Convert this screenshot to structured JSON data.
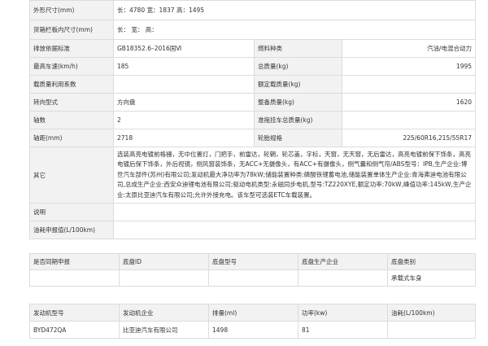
{
  "spec": {
    "rows": [
      {
        "type": "wide",
        "label": "外形尺寸(mm)",
        "value": "长：4780 宽：1837 高：1495"
      },
      {
        "type": "wide",
        "label": "货箱栏板内尺寸(mm)",
        "value": "长：    宽：    高："
      },
      {
        "type": "pair",
        "l1": "排放依据标准",
        "v1": "GB18352.6–2016国Ⅵ",
        "l2": "燃料种类",
        "v2": "汽油/电混合动力"
      },
      {
        "type": "pair",
        "l1": "最高车速(km/h)",
        "v1": "185",
        "l2": "总质量(kg)",
        "v2": "1995"
      },
      {
        "type": "pair",
        "l1": "载质量利用系数",
        "v1": "",
        "l2": "额定载质量(kg)",
        "v2": ""
      },
      {
        "type": "pair",
        "l1": "转向型式",
        "v1": "方向盘",
        "l2": "整备质量(kg)",
        "v2": "1620"
      },
      {
        "type": "pair",
        "l1": "轴数",
        "v1": "2",
        "l2": "准拖挂车总质量(kg)",
        "v2": ""
      },
      {
        "type": "pair",
        "l1": "轴距(mm)",
        "v1": "2718",
        "l2": "轮胎规格",
        "v2": "225/60R16,215/55R17"
      },
      {
        "type": "other",
        "label": "其它",
        "value": "选装高亮电镀前格栅，无中位置灯，门把手，前雷达，轮辋，轮芯盖，字标，天窗，无天窗，无后雷达，高亮电镀前保下饰条，高亮电镀后保下饰条，外后视镜，侧风窗装饰条，无ACC+无摄像头，有ACC+有摄像头，侧气囊和侧气帘/ABS型号：IPB,生产企业:博世汽车部件(苏州)有限公司;发动机最大净功率为78kW;储能装置种类:磷酸铁锂蓄电池,储能装置单体生产企业:青海弗迪电池有限公司,总成生产企业:西安众迪锂电池有限公司;驱动电机类型:永磁同步电机,型号:TZ220XYE,额定功率:70kW,峰值功率:145kW,生产企业:太原比亚迪汽车有限公司;允许外接充电。该车型可选装ETC车载装置。"
      },
      {
        "type": "wide",
        "label": "说明",
        "value": ""
      },
      {
        "type": "wide",
        "label": "油耗申报值(L/100km)",
        "value": ""
      }
    ]
  },
  "chassis": {
    "headers": [
      "是否同期申报",
      "底盘ID",
      "底盘型号",
      "底盘生产企业",
      "底盘类别"
    ],
    "values": [
      "",
      "",
      "",
      "",
      "承载式车身"
    ]
  },
  "engine": {
    "headers": [
      "发动机型号",
      "发动机企业",
      "排量(ml)",
      "功率(kw)",
      "油耗(L/100km)"
    ],
    "values": [
      "BYD472QA",
      "比亚迪汽车有限公司",
      "1498",
      "81",
      ""
    ]
  }
}
